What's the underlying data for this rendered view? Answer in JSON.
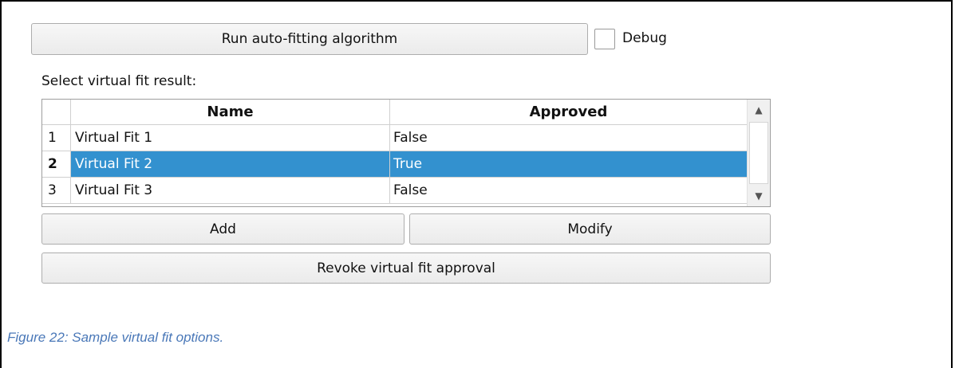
{
  "run_button": "Run auto-fitting algorithm",
  "debug": {
    "label": "Debug",
    "checked": false
  },
  "select_label": "Select virtual fit result:",
  "table": {
    "headers": {
      "name": "Name",
      "approved": "Approved"
    },
    "rows": [
      {
        "num": "1",
        "name": "Virtual Fit 1",
        "approved": "False",
        "selected": false
      },
      {
        "num": "2",
        "name": "Virtual Fit 2",
        "approved": "True",
        "selected": true
      },
      {
        "num": "3",
        "name": "Virtual Fit 3",
        "approved": "False",
        "selected": false
      }
    ],
    "selection_color": "#3391cf"
  },
  "buttons": {
    "add": "Add",
    "modify": "Modify",
    "revoke": "Revoke virtual fit approval"
  },
  "icons": {
    "scroll_up": "chevron-up-icon",
    "scroll_down": "chevron-down-icon"
  },
  "caption": "Figure 22: Sample virtual fit options.",
  "caption_color": "#4a78b8"
}
